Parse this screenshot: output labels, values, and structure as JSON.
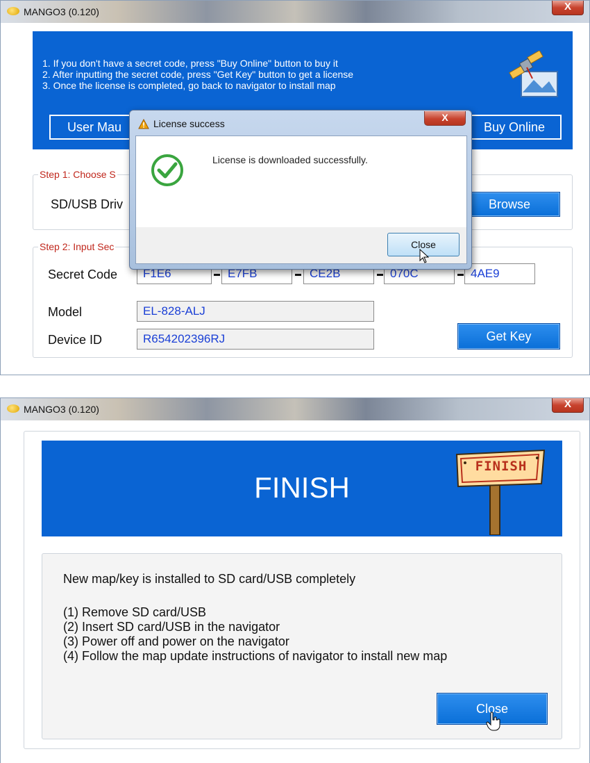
{
  "window1": {
    "title": "MANGO3 (0.120)",
    "close_glyph": "X",
    "instructions": [
      "1. If you don't have a secret code, press \"Buy Online\" button to buy it",
      "2. After inputting the secret code, press \"Get Key\" button to get a license",
      "3. Once the license is completed, go back to navigator to install map"
    ],
    "user_manual_label": "User Mau",
    "buy_online_label": "Buy Online",
    "step1_label": "Step 1: Choose S",
    "sd_usb_label": "SD/USB Driv",
    "browse_label": "Browse",
    "step2_label": "Step 2: Input Sec",
    "secret_code_label": "Secret Code",
    "secret_code": [
      "F1E6",
      "E7FB",
      "CE2B",
      "070C",
      "4AE9"
    ],
    "model_label": "Model",
    "model_value": "EL-828-ALJ",
    "device_id_label": "Device ID",
    "device_id_value": "R654202396RJ",
    "get_key_label": "Get Key"
  },
  "dialog": {
    "title": "License success",
    "close_glyph": "X",
    "message": "License is downloaded successfully.",
    "close_label": "Close"
  },
  "window2": {
    "title": "MANGO3 (0.120)",
    "close_glyph": "X",
    "banner_title": "FINISH",
    "sign_text": "FINISH",
    "heading": "New map/key is installed to SD card/USB completely",
    "steps": [
      "(1) Remove SD card/USB",
      "(2) Insert SD card/USB in the navigator",
      "(3) Power off and power on the navigator",
      "(4) Follow the map update instructions of navigator to install new map"
    ],
    "close_label": "Close"
  },
  "colors": {
    "banner_blue": "#0a64d3",
    "step_red": "#c0271c",
    "field_text_blue": "#1a3fd6"
  }
}
